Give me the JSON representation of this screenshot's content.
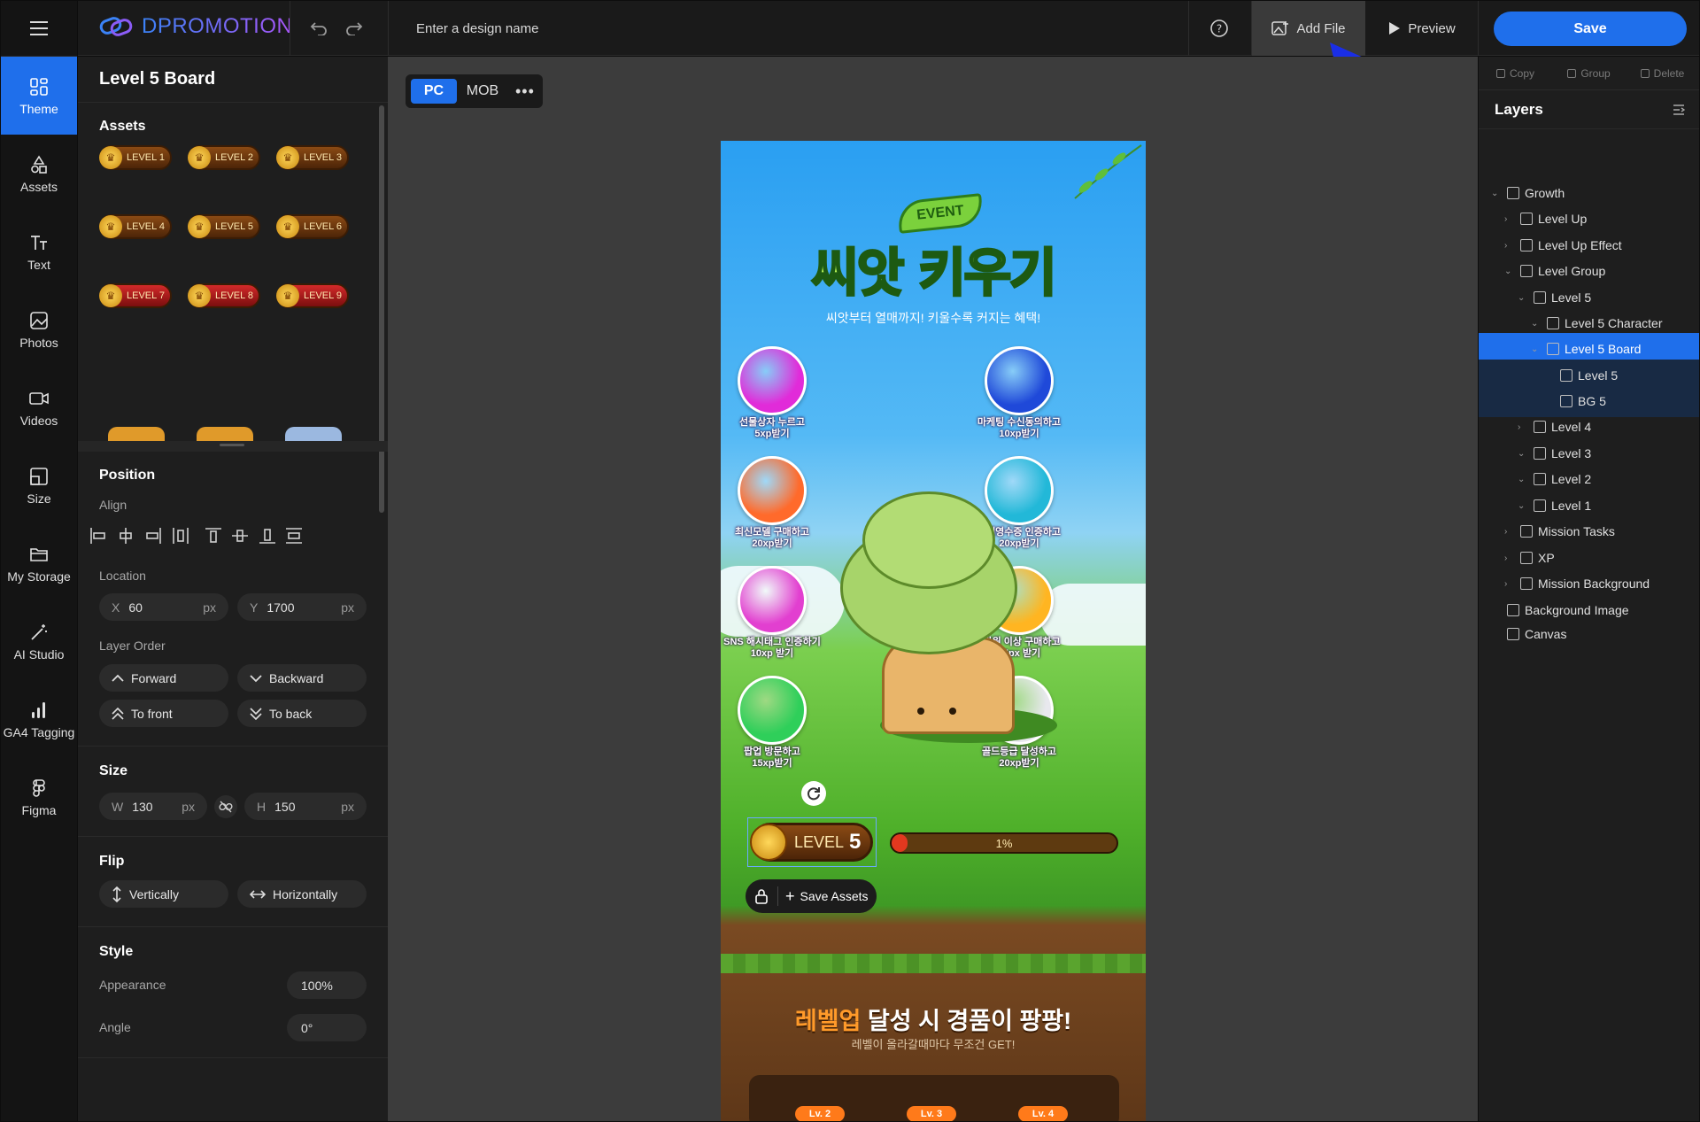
{
  "app": {
    "brand": "DPROMOTION",
    "design_name_placeholder": "Enter a design name"
  },
  "toolbar": {
    "add_file": "Add File",
    "preview": "Preview",
    "save": "Save"
  },
  "rail": [
    {
      "label": "Theme",
      "icon": "theme-icon",
      "active": true
    },
    {
      "label": "Assets",
      "icon": "assets-icon"
    },
    {
      "label": "Text",
      "icon": "text-icon"
    },
    {
      "label": "Photos",
      "icon": "photos-icon"
    },
    {
      "label": "Videos",
      "icon": "videos-icon"
    },
    {
      "label": "Size",
      "icon": "size-icon"
    },
    {
      "label": "My Storage",
      "icon": "storage-icon"
    },
    {
      "label": "AI Studio",
      "icon": "ai-studio-icon"
    },
    {
      "label": "GA4 Tagging",
      "icon": "ga4-icon"
    },
    {
      "label": "Figma",
      "icon": "figma-icon"
    }
  ],
  "left": {
    "title": "Level 5 Board",
    "assets_title": "Assets",
    "assets": [
      "LEVEL 1",
      "LEVEL 2",
      "LEVEL 3",
      "LEVEL 4",
      "LEVEL 5",
      "LEVEL 6",
      "LEVEL 7",
      "LEVEL 8",
      "LEVEL 9"
    ],
    "position_title": "Position",
    "align_label": "Align",
    "location_label": "Location",
    "x_label": "X",
    "x_value": "60",
    "x_unit": "px",
    "y_label": "Y",
    "y_value": "1700",
    "y_unit": "px",
    "layer_order_label": "Layer Order",
    "forward": "Forward",
    "backward": "Backward",
    "to_front": "To front",
    "to_back": "To back",
    "size_title": "Size",
    "w_label": "W",
    "w_value": "130",
    "w_unit": "px",
    "h_label": "H",
    "h_value": "150",
    "h_unit": "px",
    "flip_title": "Flip",
    "vertically": "Vertically",
    "horizontally": "Horizontally",
    "style_title": "Style",
    "appearance_label": "Appearance",
    "appearance_value": "100%",
    "angle_label": "Angle",
    "angle_value": "0°"
  },
  "canvas": {
    "tab_pc": "PC",
    "tab_mob": "MOB",
    "event_badge": "EVENT",
    "headline": "씨앗 키우기",
    "subheadline": "씨앗부터 열매까지! 키울수록 커지는 혜택!",
    "missions_left": [
      {
        "line1": "선물상자 누르고",
        "line2": "5xp받기",
        "color": "#e12bd9"
      },
      {
        "line1": "최신모델 구매하고",
        "line2": "20xp받기",
        "color": "#ff6a2b"
      },
      {
        "line1": "SNS 해시태그 인증하기",
        "line2": "10xp 받기",
        "color": "#e23fd0"
      },
      {
        "line1": "팝업 방문하고",
        "line2": "15xp받기",
        "color": "#2fcf5a"
      }
    ],
    "missions_right": [
      {
        "line1": "마케팅 수신동의하고",
        "line2": "10xp받기",
        "color": "#1f49d9"
      },
      {
        "line1": "구매영수증 인증하고",
        "line2": "20xp받기",
        "color": "#22b8d8"
      },
      {
        "line1": "5만원 이상 구매하고",
        "line2": "15px 받기",
        "color": "#ffb521"
      },
      {
        "line1": "골드등급 달성하고",
        "line2": "20xp받기",
        "color": "#e8e8ee"
      }
    ],
    "level_word": "LEVEL",
    "level_num": "5",
    "progress_label": "1%",
    "progress": 0.01,
    "save_assets": "Save Assets",
    "reward_title_highlight": "레벨업",
    "reward_title_rest": " 달성 시 경품이 팡팡!",
    "reward_sub": "레벨이 올라갈때마다 무조건 GET!",
    "tiers": [
      "Lv. 2",
      "Lv. 3",
      "Lv. 4"
    ]
  },
  "right": {
    "actions": [
      "Copy",
      "Group",
      "Delete"
    ],
    "layers_title": "Layers",
    "layers": [
      {
        "label": "Growth",
        "depth": 0,
        "chev": "v"
      },
      {
        "label": "Level Up",
        "depth": 1,
        "chev": ">"
      },
      {
        "label": "Level Up Effect",
        "depth": 1,
        "chev": ">"
      },
      {
        "label": "Level Group",
        "depth": 1,
        "chev": "v"
      },
      {
        "label": "Level 5",
        "depth": 2,
        "chev": "v"
      },
      {
        "label": "Level 5 Character",
        "depth": 3,
        "chev": "v"
      },
      {
        "label": "Level 5 Board",
        "depth": 3,
        "chev": "v",
        "selected": true
      },
      {
        "label": "Level 5",
        "depth": 4,
        "chev": "",
        "child": true
      },
      {
        "label": "BG 5",
        "depth": 4,
        "chev": "",
        "child": true
      },
      {
        "label": "Level 4",
        "depth": 2,
        "chev": ">"
      },
      {
        "label": "Level 3",
        "depth": 2,
        "chev": "v"
      },
      {
        "label": "Level 2",
        "depth": 2,
        "chev": "v"
      },
      {
        "label": "Level 1",
        "depth": 2,
        "chev": "v"
      },
      {
        "label": "Mission Tasks",
        "depth": 1,
        "chev": ">"
      },
      {
        "label": "XP",
        "depth": 1,
        "chev": ">"
      },
      {
        "label": "Mission Background",
        "depth": 1,
        "chev": ">"
      },
      {
        "label": "Background Image",
        "depth": 0,
        "chev": ""
      },
      {
        "label": "Canvas",
        "depth": 0,
        "chev": ""
      }
    ]
  },
  "colors": {
    "accent": "#1f6feb",
    "panel": "#1e1e1e",
    "canvas_bg": "#3c3c3c"
  }
}
